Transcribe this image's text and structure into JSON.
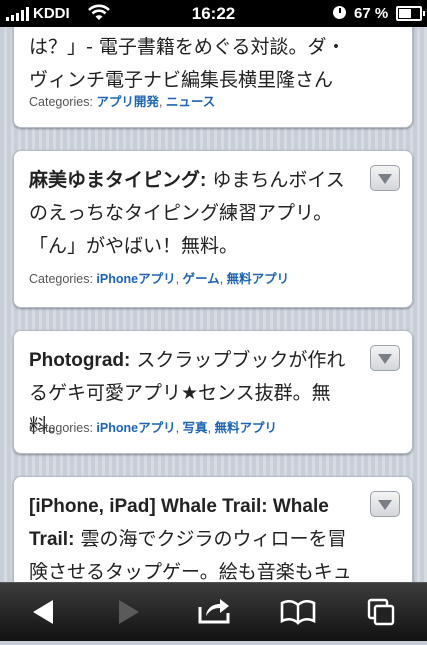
{
  "status_bar": {
    "carrier": "KDDI",
    "time": "16:22",
    "battery_percent": "67 %",
    "battery_level": 0.67
  },
  "posts": [
    {
      "title_bold": "",
      "title_rest": "は？」- 電子書籍をめぐる対談。ダ・ヴィンチ電子ナビ編集長横里隆さん",
      "categories_label": "Categories:",
      "categories": [
        "アプリ開発",
        "ニュース"
      ]
    },
    {
      "title_bold": "麻美ゆまタイピング:",
      "title_rest": " ゆまちんボイスのえっちなタイピング練習アプリ。「ん」がやばい！無料。",
      "categories_label": "Categories:",
      "categories": [
        "iPhoneアプリ",
        "ゲーム",
        "無料アプリ"
      ]
    },
    {
      "title_bold": "Photograd:",
      "title_rest": " スクラップブックが作れるゲキ可愛アプリ★センス抜群。無料。",
      "categories_label": "Categories:",
      "categories": [
        "iPhoneアプリ",
        "写真",
        "無料アプリ"
      ]
    },
    {
      "title_bold": "[iPhone, iPad] Whale Trail: Whale Trail:",
      "title_rest": " 雲の海でクジラのウィローを冒険させるタップゲー。絵も音楽もキュート♪",
      "categories_label": "",
      "categories": []
    }
  ],
  "toolbar": {
    "icons": [
      "back-arrow-icon",
      "forward-arrow-icon",
      "share-icon",
      "bookmarks-icon",
      "tabs-icon"
    ]
  },
  "colors": {
    "link": "#1d64b6",
    "statusbar": "#000000",
    "toolbar": "#1e1e1e"
  }
}
